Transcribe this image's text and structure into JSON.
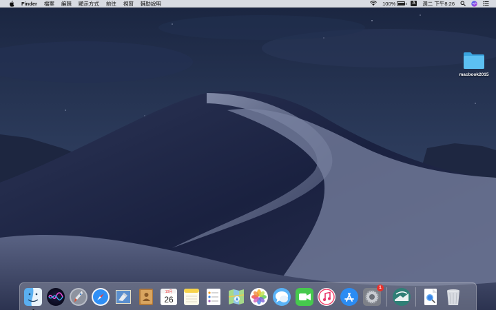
{
  "menubar": {
    "app_name": "Finder",
    "menus": [
      "檔案",
      "編輯",
      "顯示方式",
      "前往",
      "視窗",
      "輔助說明"
    ],
    "battery_percent": "100%",
    "battery_level": 1.0,
    "input_source": "A",
    "clock": "週二 下午8:26",
    "icons": [
      "apple-icon",
      "wifi-icon",
      "battery-icon",
      "input-source-icon",
      "spotlight-icon",
      "siri-icon",
      "notification-center-icon"
    ]
  },
  "desktop": {
    "folder_label": "macbook2015",
    "folder_color": "#4fb8ee"
  },
  "dock": {
    "calendar_month": "10月",
    "calendar_day": "26",
    "system_prefs_badge": "1",
    "apps": [
      "finder",
      "siri",
      "launchpad",
      "safari",
      "mail",
      "contacts",
      "calendar",
      "notes",
      "reminders",
      "maps",
      "photos",
      "messages",
      "facetime",
      "itunes",
      "app-store",
      "system-preferences",
      "rstudio",
      "preview",
      "trash"
    ]
  },
  "colors": {
    "sky_top": "#1c2740",
    "sky_bottom": "#3a4a6a",
    "dune_dark": "#141a30",
    "dune_light": "#8a93b0",
    "menubar": "#e8eaf0",
    "badge": "#e8322d"
  }
}
